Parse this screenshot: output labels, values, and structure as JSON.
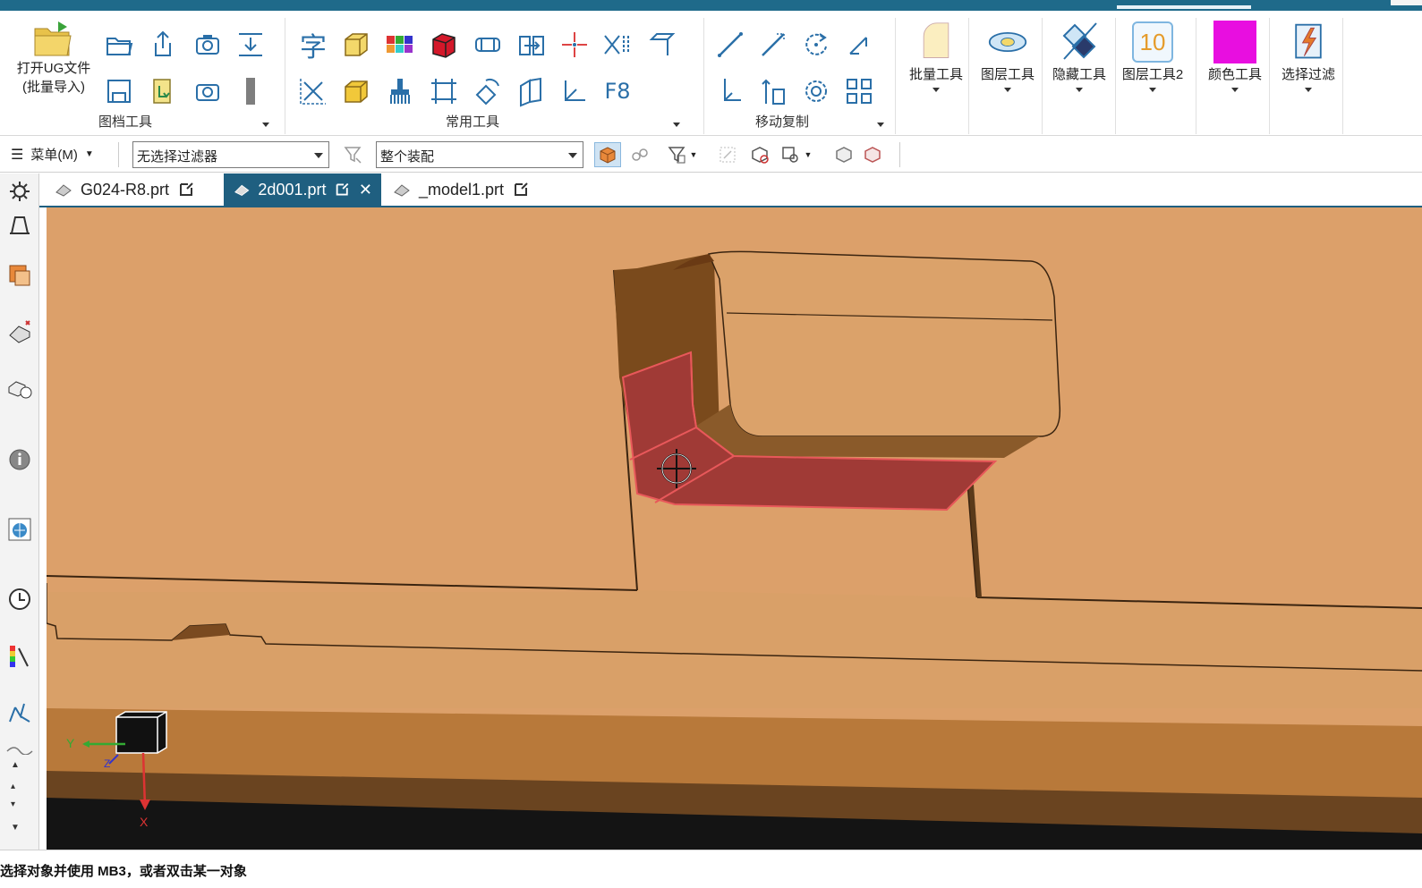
{
  "ribbon": {
    "groups": [
      {
        "label": "图档工具"
      },
      {
        "label": "常用工具"
      },
      {
        "label": "移动复制"
      }
    ],
    "open_ug": {
      "line1": "打开UG文件",
      "line2": "(批量导入)"
    },
    "text_tool_glyph": "字",
    "f8_glyph": "F8",
    "big_buttons": [
      {
        "label": "批量工具",
        "icon": "batch-tool-icon"
      },
      {
        "label": "图层工具",
        "icon": "layer-tool-icon"
      },
      {
        "label": "隐藏工具",
        "icon": "hide-tool-icon"
      },
      {
        "label": "图层工具2",
        "icon": "layer-tool2-icon",
        "badge": "10"
      },
      {
        "label": "颜色工具",
        "icon": "color-tool-icon",
        "swatch": "#e80ee0"
      },
      {
        "label": "选择过滤",
        "icon": "select-filter-icon"
      }
    ]
  },
  "cmdbar": {
    "menu_label": "菜单(M)",
    "filter_select": "无选择过滤器",
    "scope_select": "整个装配"
  },
  "tabs": [
    {
      "label": "G024-R8.prt",
      "active": false
    },
    {
      "label": "2d001.prt",
      "active": true
    },
    {
      "label": "_model1.prt",
      "active": false
    }
  ],
  "viewport": {
    "background_color": "#dca06a",
    "highlight_color": "#a03a36",
    "triad": {
      "x_label": "X",
      "y_label": "Y",
      "z_label": "Z"
    }
  },
  "status": {
    "text": "选择对象并使用 MB3，或者双击某一对象"
  }
}
